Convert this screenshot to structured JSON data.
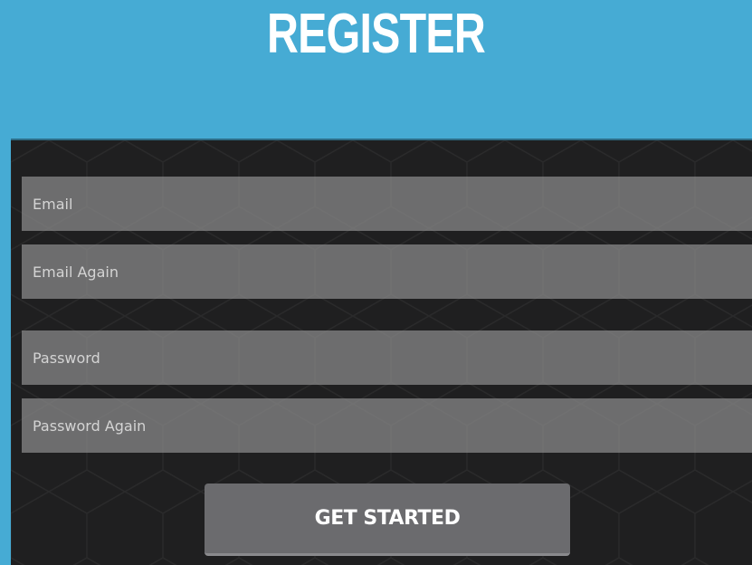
{
  "header": {
    "title": "REGISTER"
  },
  "form": {
    "email_placeholder": "Email",
    "email_again_placeholder": "Email Again",
    "password_placeholder": "Password",
    "password_again_placeholder": "Password Again",
    "submit_label": "GET STARTED"
  },
  "colors": {
    "header_background": "#46abd4",
    "panel_background": "#1f1f20",
    "field_background": "#8c8c8c",
    "button_background": "#6b6b6e",
    "title_text": "#ffffff"
  }
}
